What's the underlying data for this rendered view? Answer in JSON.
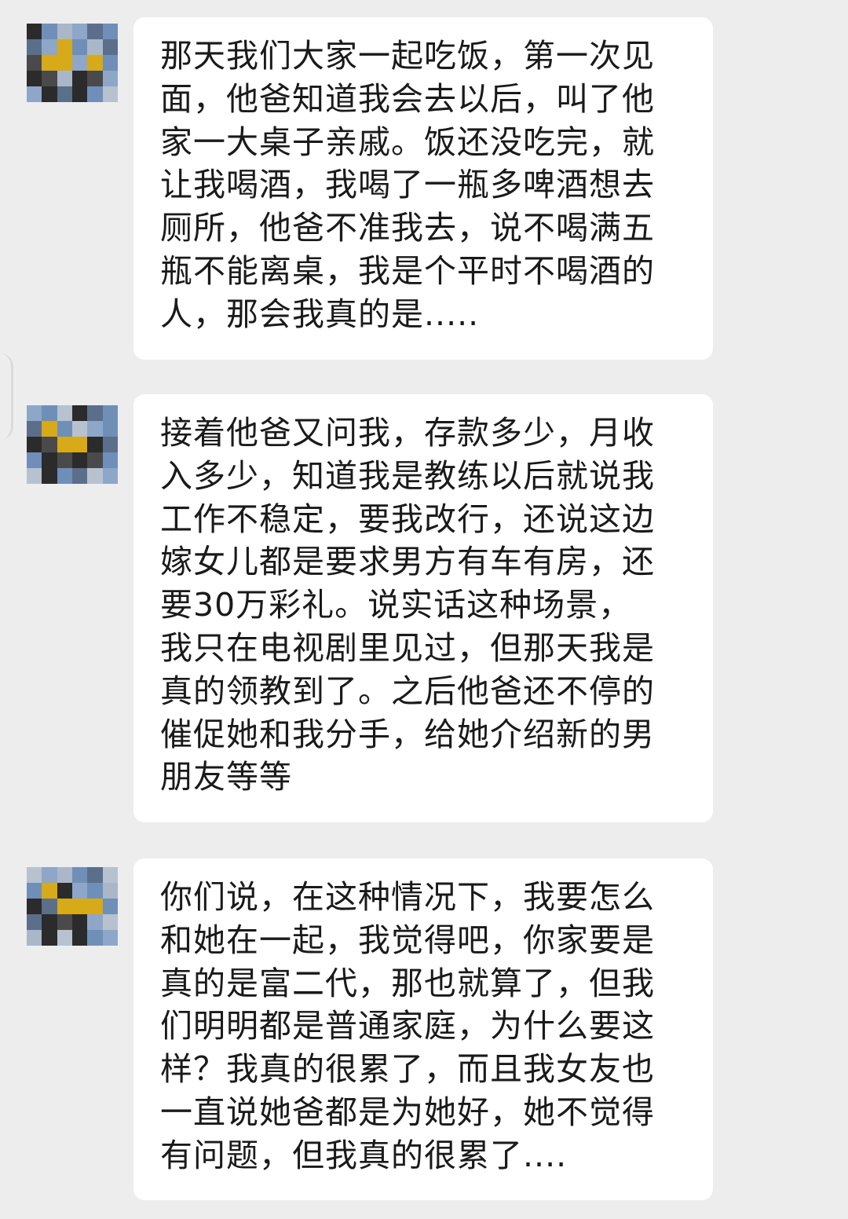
{
  "chat": {
    "messages": [
      {
        "sender_avatar": "pixelated-avatar",
        "text": "那天我们大家一起吃饭，第一次见\n面，他爸知道我会去以后，叫了他\n家一大桌子亲戚。饭还没吃完，就\n让我喝酒，我喝了一瓶多啤酒想去\n厕所，他爸不准我去，说不喝满五\n瓶不能离桌，我是个平时不喝酒的\n人，那会我真的是....."
      },
      {
        "sender_avatar": "pixelated-avatar",
        "text": "接着他爸又问我，存款多少，月收\n入多少，知道我是教练以后就说我\n工作不稳定，要我改行，还说这边\n嫁女儿都是要求男方有车有房，还\n要30万彩礼。说实话这种场景，\n我只在电视剧里见过，但那天我是\n真的领教到了。之后他爸还不停的\n催促她和我分手，给她介绍新的男\n朋友等等"
      },
      {
        "sender_avatar": "pixelated-avatar",
        "text": "你们说，在这种情况下，我要怎么\n和她在一起，我觉得吧，你家要是\n真的是富二代，那也就算了，但我\n们明明都是普通家庭，为什么要这\n样？我真的很累了，而且我女友也\n一直说她爸都是为她好，她不觉得\n有问题，但我真的很累了...."
      }
    ]
  },
  "colors": {
    "background": "#ededed",
    "bubble": "#ffffff",
    "text": "#1a1a1a",
    "avatar_palette": [
      "#2b2b2b",
      "#6f8fb8",
      "#8ea6c8",
      "#a9b7c9",
      "#d6aa18",
      "#4a4a4a",
      "#b7c2cf",
      "#5b6f8b"
    ]
  }
}
